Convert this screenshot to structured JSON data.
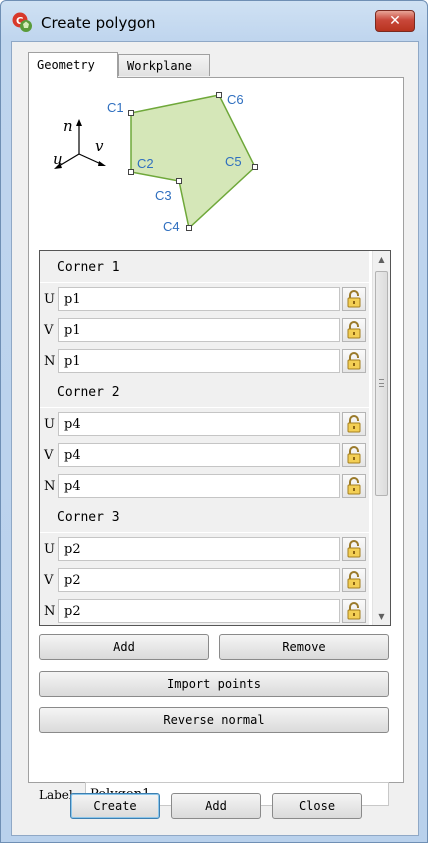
{
  "window": {
    "title": "Create polygon",
    "close_glyph": "✕"
  },
  "tabs": [
    {
      "label": "Geometry",
      "active": true
    },
    {
      "label": "Workplane",
      "active": false
    }
  ],
  "diagram": {
    "corner_labels": [
      "C1",
      "C2",
      "C3",
      "C4",
      "C5",
      "C6"
    ],
    "axis_labels": {
      "n": "n",
      "u": "u",
      "v": "v"
    },
    "fill_color": "#d5e7b8",
    "stroke_color": "#6fa83a",
    "label_color": "#2f6fbf"
  },
  "corners": [
    {
      "title": "Corner 1",
      "rows": [
        {
          "axis": "U",
          "value": "p1"
        },
        {
          "axis": "V",
          "value": "p1"
        },
        {
          "axis": "N",
          "value": "p1"
        }
      ]
    },
    {
      "title": "Corner 2",
      "rows": [
        {
          "axis": "U",
          "value": "p4"
        },
        {
          "axis": "V",
          "value": "p4"
        },
        {
          "axis": "N",
          "value": "p4"
        }
      ]
    },
    {
      "title": "Corner 3",
      "rows": [
        {
          "axis": "U",
          "value": "p2"
        },
        {
          "axis": "V",
          "value": "p2"
        },
        {
          "axis": "N",
          "value": "p2"
        }
      ]
    }
  ],
  "list_actions": {
    "add_label": "Add",
    "remove_label": "Remove",
    "import_label": "Import points",
    "reverse_label": "Reverse normal"
  },
  "label_field": {
    "caption": "Label",
    "value": "Polygon1"
  },
  "footer": {
    "create_label": "Create",
    "add_label": "Add",
    "close_label": "Close"
  }
}
